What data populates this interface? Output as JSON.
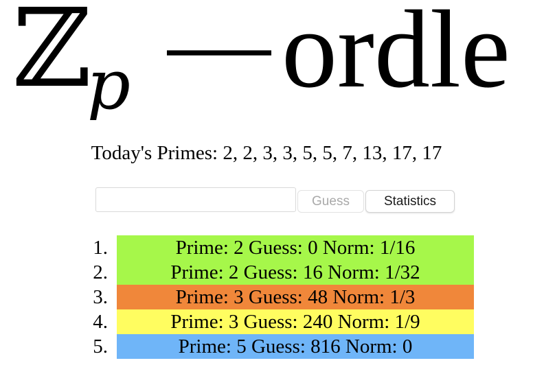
{
  "logo": {
    "z_glyph": "ℤ",
    "subscript": "p",
    "dash": "—",
    "word": "ordle"
  },
  "primes_line": "Today's Primes: 2, 2, 3, 3, 5, 5, 7, 13, 17, 17",
  "controls": {
    "input_value": "",
    "guess_label": "Guess",
    "guess_enabled": false,
    "stats_label": "Statistics"
  },
  "guesses": [
    {
      "number": "1.",
      "text": "Prime: 2 Guess: 0 Norm: 1/16",
      "color": "#a6f74a"
    },
    {
      "number": "2.",
      "text": "Prime: 2 Guess: 16 Norm: 1/32",
      "color": "#a6f74a"
    },
    {
      "number": "3.",
      "text": "Prime: 3 Guess: 48 Norm: 1/3",
      "color": "#f0873a"
    },
    {
      "number": "4.",
      "text": "Prime: 3 Guess: 240 Norm: 1/9",
      "color": "#fffd60"
    },
    {
      "number": "5.",
      "text": "Prime: 5 Guess: 816 Norm: 0",
      "color": "#6fb5f8"
    }
  ]
}
